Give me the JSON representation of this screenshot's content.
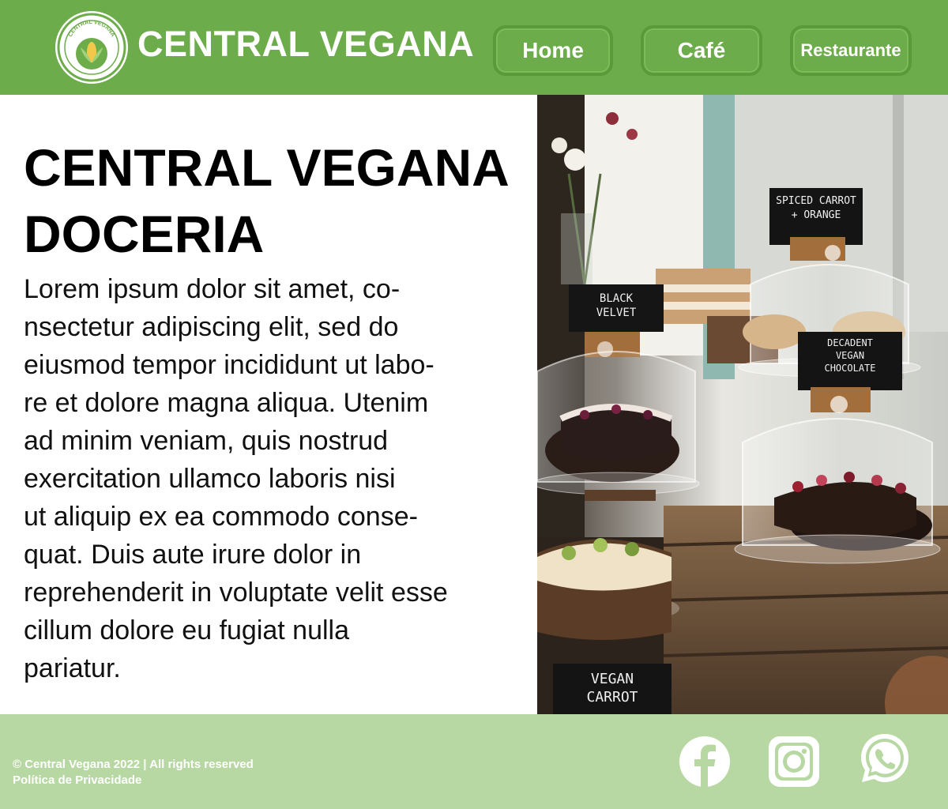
{
  "header": {
    "logo_text": "CENTRAL VEGANA",
    "brand": "CENTRAL VEGANA",
    "nav": [
      {
        "label": "Home"
      },
      {
        "label": "Café"
      },
      {
        "label": "Restaurante"
      }
    ]
  },
  "main": {
    "title_line1": "CENTRAL VEGANA",
    "title_line2": "DOCERIA",
    "body_lines": [
      "Lorem ipsum dolor sit amet, co-",
      "nsectetur adipiscing elit, sed do",
      "eiusmod tempor incididunt ut labo-",
      "re et dolore magna aliqua. Utenim",
      "ad minim veniam, quis nostrud",
      "exercitation ullamco laboris nisi",
      "ut aliquip ex ea commodo conse-",
      "quat. Duis aute irure dolor in",
      "reprehenderit in voluptate velit esse",
      "cillum dolore eu fugiat nulla",
      "pariatur."
    ],
    "photo_signs": {
      "spiced_line1": "SPICED CARROT",
      "spiced_line2": "+ ORANGE",
      "black_line1": "BLACK",
      "black_line2": "VELVET",
      "decadent_line1": "DECADENT",
      "decadent_line2": "VEGAN",
      "decadent_line3": "CHOCOLATE",
      "carrot_line1": "VEGAN",
      "carrot_line2": "CARROT"
    }
  },
  "footer": {
    "copyright": "© Central Vegana 2022 | All rights reserved",
    "privacy": "Política de Privacidade",
    "social": [
      {
        "icon": "facebook-icon"
      },
      {
        "icon": "instagram-icon"
      },
      {
        "icon": "whatsapp-icon"
      }
    ]
  },
  "colors": {
    "header_green": "#6dac4a",
    "footer_green": "#b7d8a3",
    "text": "#000000",
    "white": "#ffffff"
  }
}
